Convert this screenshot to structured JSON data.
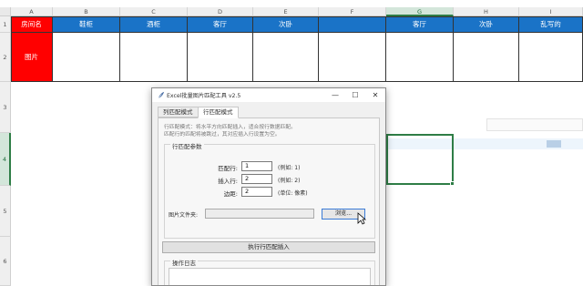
{
  "spreadsheet": {
    "column_headers": [
      "A",
      "B",
      "C",
      "D",
      "E",
      "F",
      "G",
      "H",
      "I"
    ],
    "row_headers": [
      "1",
      "2",
      "3",
      "4",
      "5",
      "6"
    ],
    "selected_cell": "G4",
    "header_cells": [
      "房间名",
      "鞋柜",
      "酒柜",
      "客厅",
      "次卧",
      "",
      "客厅",
      "次卧",
      "乱写的"
    ],
    "row2_label": "图片",
    "colors": {
      "header_blue": "#1a73c7",
      "label_red": "#ff0000",
      "selection_green": "#2e7d46"
    }
  },
  "dialog": {
    "title": "Excel批量图片匹配工具 v2.5",
    "app_icon": "feather-icon",
    "window_controls": {
      "minimize": "—",
      "maximize": "☐",
      "close": "✕"
    },
    "tabs": [
      {
        "label": "列匹配模式",
        "active": false
      },
      {
        "label": "行匹配模式",
        "active": true
      }
    ],
    "description_lines": [
      "行匹配模式：将水平方向匹配插入，适合按行数据匹配。",
      "匹配行的匹配将被跳过，其对应插入行设置为空。"
    ],
    "params_group_title": "行匹配参数",
    "params": [
      {
        "label": "匹配行:",
        "value": "1",
        "hint": "(例如: 1)"
      },
      {
        "label": "插入行:",
        "value": "2",
        "hint": "(例如: 2)"
      },
      {
        "label": "边距:",
        "value": "2",
        "hint": "(单位: 像素)"
      }
    ],
    "folder_label": "图片文件夹:",
    "folder_value": "",
    "browse_label": "浏览...",
    "run_label": "执行行匹配插入",
    "log_group_title": "操作日志",
    "log_text": ""
  }
}
